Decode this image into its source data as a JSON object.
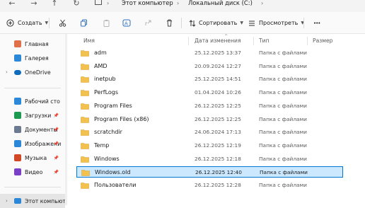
{
  "addressbar": {
    "nav": [
      "←",
      "→",
      "↑",
      "↻"
    ],
    "breadcrumbs": [
      "Этот компьютер",
      "Локальный диск (C:)"
    ],
    "separator": "›"
  },
  "toolbar": {
    "create_label": "Создать",
    "sort_label": "Сортировать",
    "view_label": "Просмотреть",
    "more_label": "•••"
  },
  "sidebar": {
    "items": [
      {
        "label": "Главная",
        "icon": "home-icon",
        "color": "#e0704a"
      },
      {
        "label": "Галерея",
        "icon": "gallery-icon",
        "color": "#2b88d8"
      },
      {
        "label": "OneDrive",
        "icon": "cloud-icon",
        "color": "#0f6cbd"
      },
      {
        "label": "Рабочий сто",
        "icon": "desktop-icon",
        "color": "#2b88d8"
      },
      {
        "label": "Загрузки",
        "icon": "download-icon",
        "color": "#1c9a52"
      },
      {
        "label": "Документы",
        "icon": "documents-icon",
        "color": "#6b7a8f"
      },
      {
        "label": "Изображени",
        "icon": "pictures-icon",
        "color": "#2b88d8"
      },
      {
        "label": "Музыка",
        "icon": "music-icon",
        "color": "#d24726"
      },
      {
        "label": "Видео",
        "icon": "video-icon",
        "color": "#7a3fc7"
      },
      {
        "label": "Этот компьюте",
        "icon": "this-pc-icon",
        "color": "#2b88d8"
      }
    ]
  },
  "columns": [
    "Имя",
    "Дата изменения",
    "Тип",
    "Размер"
  ],
  "rows": [
    {
      "name": "adm",
      "date": "25.12.2025 13:37",
      "type": "Папка с файлами"
    },
    {
      "name": "AMD",
      "date": "20.09.2024 12:27",
      "type": "Папка с файлами"
    },
    {
      "name": "inetpub",
      "date": "25.12.2025 14:51",
      "type": "Папка с файлами"
    },
    {
      "name": "PerfLogs",
      "date": "01.04.2024 10:26",
      "type": "Папка с файлами"
    },
    {
      "name": "Program Files",
      "date": "26.12.2025 12:25",
      "type": "Папка с файлами"
    },
    {
      "name": "Program Files (x86)",
      "date": "26.12.2025 12:25",
      "type": "Папка с файлами"
    },
    {
      "name": "scratchdir",
      "date": "24.06.2024 17:13",
      "type": "Папка с файлами"
    },
    {
      "name": "Temp",
      "date": "26.12.2025 12:19",
      "type": "Папка с файлами"
    },
    {
      "name": "Windows",
      "date": "26.12.2025 12:18",
      "type": "Папка с файлами"
    },
    {
      "name": "Windows.old",
      "date": "26.12.2025 12:40",
      "type": "Папка с файлами",
      "selected": true
    },
    {
      "name": "Пользователи",
      "date": "26.12.2025 12:28",
      "type": "Папка с файлами"
    }
  ],
  "colors": {
    "folder": "#f2c14e",
    "selection_bg": "#cce8ff",
    "selection_border": "#0078d4",
    "accent": "#0078d4"
  }
}
